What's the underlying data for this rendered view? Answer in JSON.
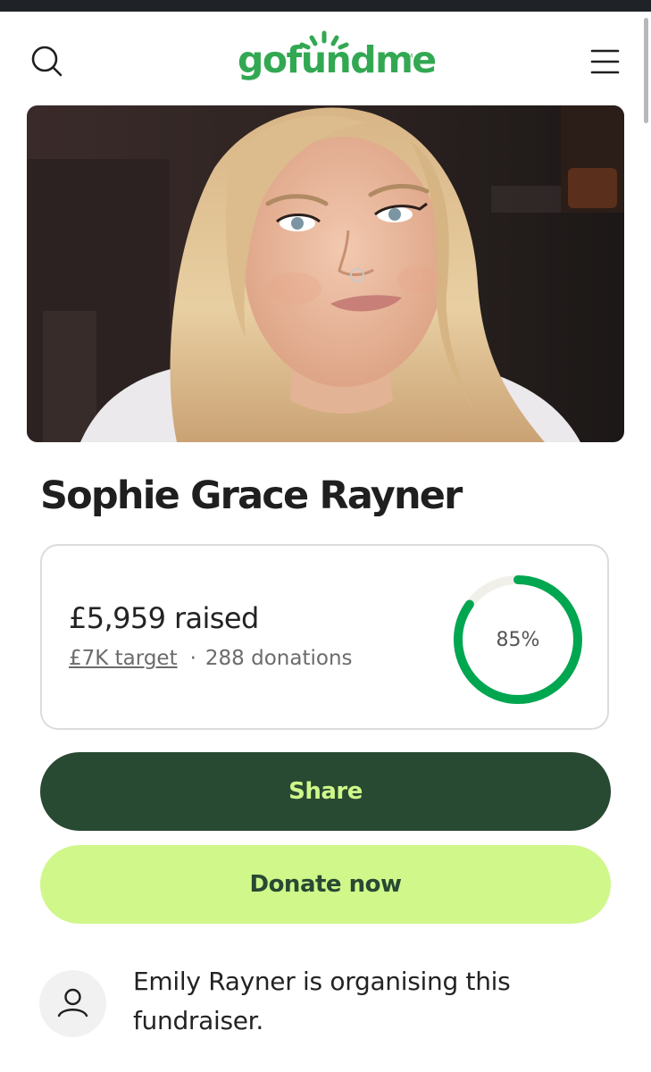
{
  "brand": {
    "logo_text": "gofundme",
    "trademark": "TM",
    "colors": {
      "brand_green": "#32a852",
      "dark_green": "#284932",
      "lime": "#cff78a",
      "progress": "#00a650"
    }
  },
  "header": {
    "search_icon": "search-icon",
    "menu_icon": "hamburger-menu-icon"
  },
  "campaign": {
    "title": "Sophie Grace Rayner",
    "raised_text": "£5,959 raised",
    "target_text": "£7K target",
    "separator": "·",
    "donations_text": "288 donations",
    "progress_label": "85%",
    "progress_fraction": 0.85
  },
  "actions": {
    "share_label": "Share",
    "donate_label": "Donate now"
  },
  "organiser": {
    "avatar_icon": "user-icon",
    "text": "Emily Rayner is organising this fundraiser."
  }
}
